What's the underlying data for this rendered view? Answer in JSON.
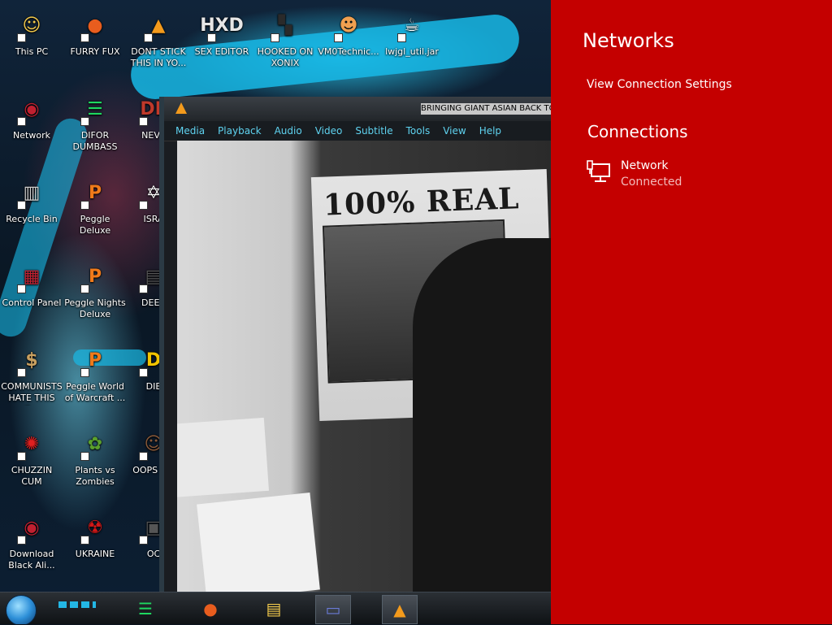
{
  "desktop": {
    "icons": [
      {
        "label": "This PC",
        "glyph": "☺",
        "color": "#f2c94c"
      },
      {
        "label": "FURRY FUX",
        "glyph": "●",
        "color": "#e85d1e"
      },
      {
        "label": "DONT STICK THIS IN YO...",
        "glyph": "▲",
        "color": "#f39a1c"
      },
      {
        "label": "SEX EDITOR",
        "glyph": "HXD",
        "color": "#e6e6e6"
      },
      {
        "label": "HOOKED ON XONIX",
        "glyph": "▚",
        "color": "#2a2a2a"
      },
      {
        "label": "VM0Technic...",
        "glyph": "☻",
        "color": "#f0a050"
      },
      {
        "label": "lwjgl_util.jar",
        "glyph": "☕",
        "color": "#ffffff"
      },
      {
        "label": "Network",
        "glyph": "◉",
        "color": "#c02030"
      },
      {
        "label": "DIFOR DUMBASS",
        "glyph": "☰",
        "color": "#1ed760"
      },
      {
        "label": "NEVE",
        "glyph": "DE",
        "color": "#c0392b"
      },
      {
        "label": "Recycle Bin",
        "glyph": "▥",
        "color": "#d0d0d0"
      },
      {
        "label": "Peggle Deluxe",
        "glyph": "P",
        "color": "#f07a1a"
      },
      {
        "label": "ISRA",
        "glyph": "✡",
        "color": "#ffffff"
      },
      {
        "label": "Control Panel",
        "glyph": "▦",
        "color": "#c02030"
      },
      {
        "label": "Peggle Nights Deluxe",
        "glyph": "P",
        "color": "#f07a1a"
      },
      {
        "label": "DEEZ",
        "glyph": "▤",
        "color": "#555555"
      },
      {
        "label": "COMMUNISTS HATE THIS G...",
        "glyph": "$",
        "color": "#c8a060"
      },
      {
        "label": "Peggle World of Warcraft ...",
        "glyph": "P",
        "color": "#f07a1a"
      },
      {
        "label": "DIE",
        "glyph": "D",
        "color": "#f2c400"
      },
      {
        "label": "CHUZZIN CUM",
        "glyph": "✺",
        "color": "#e02020"
      },
      {
        "label": "Plants vs Zombies",
        "glyph": "✿",
        "color": "#5aa02c"
      },
      {
        "label": "OOPS DO",
        "glyph": "☺",
        "color": "#8a5a3a"
      },
      {
        "label": "Download Black Ali...",
        "glyph": "◉",
        "color": "#c02030"
      },
      {
        "label": "UKRAINE",
        "glyph": "☢",
        "color": "#d01818"
      },
      {
        "label": "OC",
        "glyph": "▣",
        "color": "#555555"
      }
    ]
  },
  "vlc": {
    "title": "BRINGING GIANT ASIAN BACK TO",
    "menu": [
      "Media",
      "Playback",
      "Audio",
      "Video",
      "Subtitle",
      "Tools",
      "View",
      "Help"
    ],
    "poster_text": "100% REAL"
  },
  "taskbar": {
    "apps": [
      {
        "name": "spotify",
        "glyph": "☰",
        "color": "#1ed760"
      },
      {
        "name": "firefox",
        "glyph": "●",
        "color": "#e85d1e"
      },
      {
        "name": "file-explorer",
        "glyph": "▤",
        "color": "#f2c94c"
      },
      {
        "name": "app",
        "glyph": "▭",
        "color": "#6a7bd8"
      },
      {
        "name": "vlc",
        "glyph": "▲",
        "color": "#f39a1c"
      }
    ]
  },
  "networks": {
    "title": "Networks",
    "settings_link": "View Connection Settings",
    "section": "Connections",
    "items": [
      {
        "name": "Network",
        "status": "Connected"
      }
    ]
  },
  "colors": {
    "flyout_bg": "#c40000",
    "vlc_menu": "#5fd3f0"
  }
}
